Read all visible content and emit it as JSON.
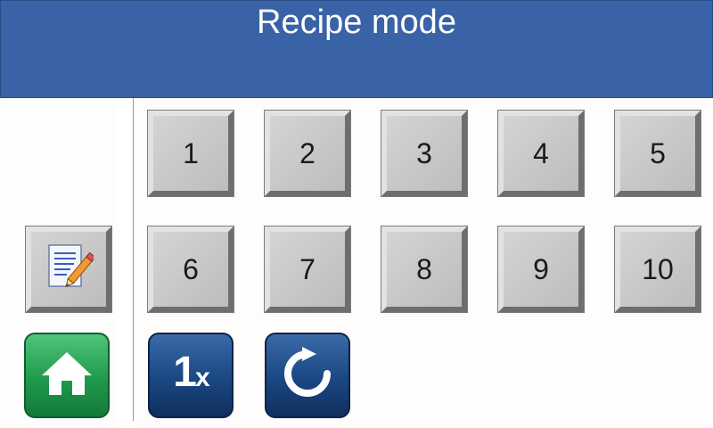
{
  "header": {
    "title": "Recipe mode"
  },
  "recipes": {
    "buttons": [
      {
        "label": "1"
      },
      {
        "label": "2"
      },
      {
        "label": "3"
      },
      {
        "label": "4"
      },
      {
        "label": "5"
      },
      {
        "label": "6"
      },
      {
        "label": "7"
      },
      {
        "label": "8"
      },
      {
        "label": "9"
      },
      {
        "label": "10"
      }
    ]
  },
  "toolbar": {
    "edit_icon": "edit-document-icon",
    "home_icon": "home-icon",
    "run_once": {
      "main": "1",
      "suffix": "x"
    },
    "reload_icon": "reload-icon"
  },
  "colors": {
    "header": "#3a62a6",
    "home": "#1f9a4c",
    "blue_button": "#1c4a86",
    "key_face": "#c8c8c8"
  }
}
